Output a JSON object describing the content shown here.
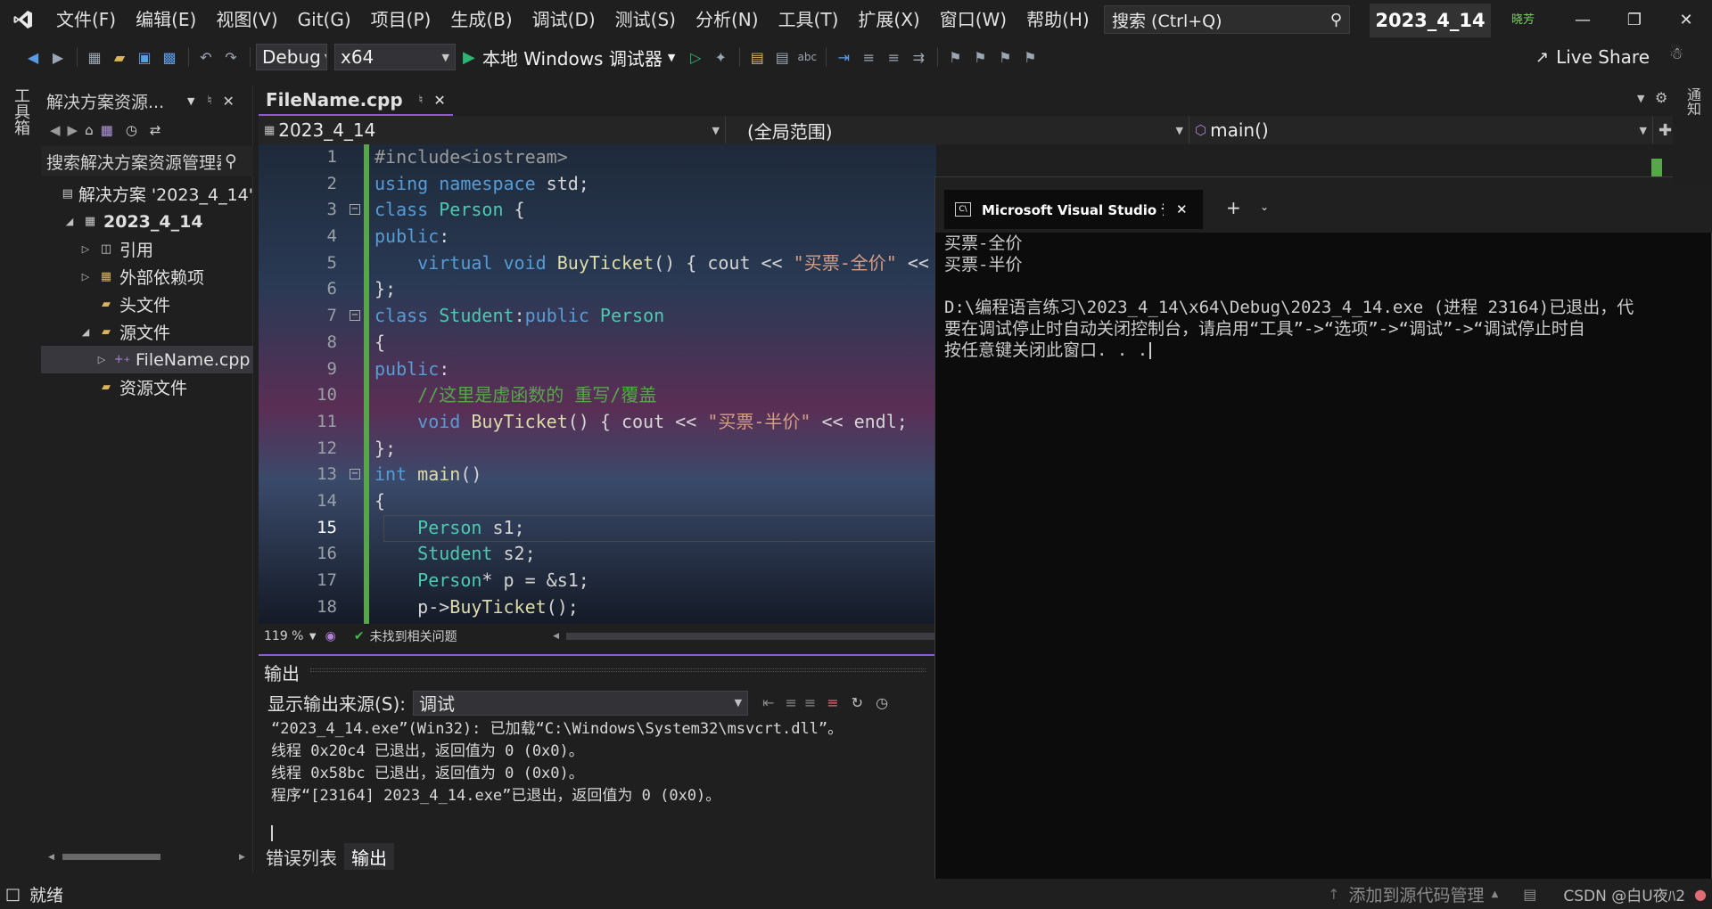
{
  "menubar": {
    "items": [
      "文件(F)",
      "编辑(E)",
      "视图(V)",
      "Git(G)",
      "项目(P)",
      "生成(B)",
      "调试(D)",
      "测试(S)",
      "分析(N)",
      "工具(T)",
      "扩展(X)",
      "窗口(W)",
      "帮助(H)"
    ],
    "search_placeholder": "搜索 (Ctrl+Q)",
    "solution_name": "2023_4_14",
    "user_initials": "晓芳"
  },
  "toolbar": {
    "config": "Debug",
    "platform": "x64",
    "debugger_label": "本地 Windows 调试器",
    "liveshare_label": "Live Share"
  },
  "toolbox": {
    "label": "工具箱"
  },
  "solution_explorer": {
    "title": "解决方案资源...",
    "search_placeholder": "搜索解决方案资源管理器",
    "tree": [
      {
        "label": "解决方案 '2023_4_14'",
        "indent": 0,
        "twisty": "",
        "icon": "solution"
      },
      {
        "label": "2023_4_14",
        "indent": 1,
        "twisty": "◢",
        "icon": "project",
        "bold": true
      },
      {
        "label": "引用",
        "indent": 2,
        "twisty": "▷",
        "icon": "reference"
      },
      {
        "label": "外部依赖项",
        "indent": 2,
        "twisty": "▷",
        "icon": "folder"
      },
      {
        "label": "头文件",
        "indent": 2,
        "twisty": "",
        "icon": "filter"
      },
      {
        "label": "源文件",
        "indent": 2,
        "twisty": "◢",
        "icon": "filter"
      },
      {
        "label": "FileName.cpp",
        "indent": 3,
        "twisty": "▷",
        "icon": "cpp",
        "selected": true
      },
      {
        "label": "资源文件",
        "indent": 2,
        "twisty": "",
        "icon": "filter"
      }
    ]
  },
  "editor": {
    "tab_label": "FileName.cpp",
    "nav_project": "2023_4_14",
    "nav_scope": "(全局范围)",
    "nav_member": "main()",
    "current_line": 15,
    "line_numbers": [
      "1",
      "2",
      "3",
      "4",
      "5",
      "6",
      "7",
      "8",
      "9",
      "10",
      "11",
      "12",
      "13",
      "14",
      "15",
      "16",
      "17",
      "18"
    ],
    "lines": [
      [
        {
          "t": "#include<iostream>",
          "c": "pp"
        }
      ],
      [
        {
          "t": "using",
          "c": "kw"
        },
        {
          "t": " "
        },
        {
          "t": "namespace",
          "c": "kw"
        },
        {
          "t": " std;"
        }
      ],
      [
        {
          "t": "class",
          "c": "kw"
        },
        {
          "t": " "
        },
        {
          "t": "Person",
          "c": "ty"
        },
        {
          "t": " {"
        }
      ],
      [
        {
          "t": "public",
          "c": "kw"
        },
        {
          "t": ":"
        }
      ],
      [
        {
          "t": "    "
        },
        {
          "t": "virtual",
          "c": "kw"
        },
        {
          "t": " "
        },
        {
          "t": "void",
          "c": "kw"
        },
        {
          "t": " "
        },
        {
          "t": "BuyTicket",
          "c": "fn"
        },
        {
          "t": "() { cout << "
        },
        {
          "t": "\"买票-全价\"",
          "c": "st"
        },
        {
          "t": " <<"
        }
      ],
      [
        {
          "t": "};"
        }
      ],
      [
        {
          "t": "class",
          "c": "kw"
        },
        {
          "t": " "
        },
        {
          "t": "Student",
          "c": "ty"
        },
        {
          "t": ":"
        },
        {
          "t": "public",
          "c": "kw"
        },
        {
          "t": " "
        },
        {
          "t": "Person",
          "c": "ty"
        }
      ],
      [
        {
          "t": "{"
        }
      ],
      [
        {
          "t": "public",
          "c": "kw"
        },
        {
          "t": ":"
        }
      ],
      [
        {
          "t": "    "
        },
        {
          "t": "//这里是虚函数的 重写/覆盖",
          "c": "cm"
        }
      ],
      [
        {
          "t": "    "
        },
        {
          "t": "void",
          "c": "kw"
        },
        {
          "t": " "
        },
        {
          "t": "BuyTicket",
          "c": "fn"
        },
        {
          "t": "() { cout << "
        },
        {
          "t": "\"买票-半价\"",
          "c": "st"
        },
        {
          "t": " << endl;"
        }
      ],
      [
        {
          "t": "};"
        }
      ],
      [
        {
          "t": "int",
          "c": "kw"
        },
        {
          "t": " "
        },
        {
          "t": "main",
          "c": "fn"
        },
        {
          "t": "()"
        }
      ],
      [
        {
          "t": "{"
        }
      ],
      [
        {
          "t": "    "
        },
        {
          "t": "Person",
          "c": "ty"
        },
        {
          "t": " s1;"
        }
      ],
      [
        {
          "t": "    "
        },
        {
          "t": "Student",
          "c": "ty"
        },
        {
          "t": " s2;"
        }
      ],
      [
        {
          "t": "    "
        },
        {
          "t": "Person",
          "c": "ty"
        },
        {
          "t": "* p = &s1;"
        }
      ],
      [
        {
          "t": "    p->"
        },
        {
          "t": "BuyTicket",
          "c": "fn"
        },
        {
          "t": "();"
        }
      ]
    ],
    "zoom": "119 %",
    "issues": "未找到相关问题"
  },
  "output": {
    "title": "输出",
    "source_label": "显示输出来源(S):",
    "source_value": "调试",
    "lines": [
      "“2023_4_14.exe”(Win32): 已加载“C:\\Windows\\System32\\msvcrt.dll”。",
      "线程 0x20c4 已退出，返回值为 0 (0x0)。",
      "线程 0x58bc 已退出，返回值为 0 (0x0)。",
      "程序“[23164] 2023_4_14.exe”已退出，返回值为 0 (0x0)。"
    ]
  },
  "bottom_tabs": [
    "错误列表",
    "输出"
  ],
  "console": {
    "tab_title": "Microsoft Visual Studio 调试控",
    "lines": [
      "买票-全价",
      "买票-半价",
      "",
      "D:\\编程语言练习\\2023_4_14\\x64\\Debug\\2023_4_14.exe (进程 23164)已退出，代",
      "要在调试停止时自动关闭控制台，请启用“工具”->“选项”->“调试”->“调试停止时自",
      "按任意键关闭此窗口. . ."
    ]
  },
  "statusbar": {
    "ready": "就绪",
    "source_control": "添加到源代码管理",
    "watermark": "CSDN @白U夜ﾊ2"
  }
}
